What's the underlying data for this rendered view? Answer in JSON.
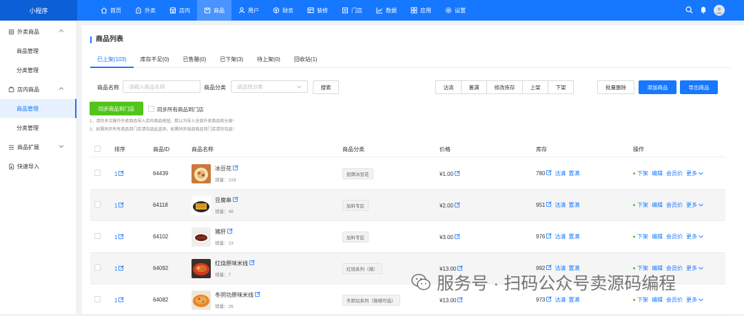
{
  "app": {
    "logo_text": "小程序"
  },
  "topnav": [
    {
      "label": "首页",
      "icon": "home-icon"
    },
    {
      "label": "外卖",
      "icon": "takeout-icon"
    },
    {
      "label": "店内",
      "icon": "store-icon"
    },
    {
      "label": "商品",
      "icon": "goods-icon",
      "active": true
    },
    {
      "label": "用户",
      "icon": "user-icon"
    },
    {
      "label": "财务",
      "icon": "finance-icon"
    },
    {
      "label": "装修",
      "icon": "decor-icon"
    },
    {
      "label": "门店",
      "icon": "shop-icon"
    },
    {
      "label": "数据",
      "icon": "chart-icon"
    },
    {
      "label": "应用",
      "icon": "apps-icon"
    },
    {
      "label": "设置",
      "icon": "gear-icon"
    }
  ],
  "sidebar": {
    "groups": [
      {
        "label": "外卖商品",
        "icon": "takeout-icon",
        "items": [
          "商品管理",
          "分类管理"
        ]
      },
      {
        "label": "店内商品",
        "icon": "store-icon",
        "items": [
          "商品管理",
          "分类管理"
        ]
      },
      {
        "label": "商品扩展",
        "icon": "list-icon",
        "items": []
      },
      {
        "label": "快速导入",
        "icon": "import-icon",
        "items": []
      }
    ],
    "active_item": "店内商品/商品管理"
  },
  "page": {
    "title": "商品列表",
    "tabs": [
      "已上架(103)",
      "库存不足(0)",
      "已售罄(0)",
      "已下架(3)",
      "待上架(0)",
      "回收站(1)"
    ],
    "active_tab": 0
  },
  "filters": {
    "name_label": "商品名称",
    "name_placeholder": "请输入商品名称",
    "category_label": "商品分类",
    "category_placeholder": "请选择分类",
    "search_button": "搜索"
  },
  "actions": {
    "group_buttons": [
      "沽清",
      "置满",
      "修改库存",
      "上架",
      "下架"
    ],
    "batch_delete": "批量删除",
    "add": "添加商品",
    "export": "导出商品"
  },
  "sync": {
    "button": "同步商品到门店",
    "checkbox_label": "同步所有商品到门店",
    "tips": [
      "1、请勿多次操作外卖商品导入店内商品按钮，默认为导入全部外卖商品和分类！",
      "2、如需同步所有商品到门店请勾选此选项，如需同步局部商品到门店请勿勾选！"
    ]
  },
  "table": {
    "headers": [
      "排序",
      "商品ID",
      "商品名称",
      "商品分类",
      "价格",
      "库存",
      "操作"
    ],
    "rows": [
      {
        "sort": "1",
        "id": "64439",
        "name": "冰豆花",
        "sales": "销量：219",
        "category": "招牌冰豆花",
        "price": "¥1.00",
        "stock": "780",
        "thumb": "bowl"
      },
      {
        "sort": "1",
        "id": "64118",
        "name": "豆腐串",
        "sales": "销量：48",
        "category": "加料专区",
        "price": "¥2.00",
        "stock": "951",
        "thumb": "tofu"
      },
      {
        "sort": "1",
        "id": "64102",
        "name": "猪肝",
        "sales": "销量：23",
        "category": "加料专区",
        "price": "¥3.00",
        "stock": "976",
        "thumb": "liver"
      },
      {
        "sort": "1",
        "id": "64092",
        "name": "红烧原味米线",
        "sales": "销量：7",
        "category": "红烧系列（辣）",
        "price": "¥13.00",
        "stock": "992",
        "thumb": "noodle"
      },
      {
        "sort": "1",
        "id": "64082",
        "name": "冬阴功原味米线",
        "sales": "销量：26",
        "category": "冬阴功系列（微辣可选）",
        "price": "¥13.00",
        "stock": "973",
        "thumb": "tomyum"
      }
    ],
    "stock_links": [
      "沽清",
      "置满"
    ],
    "ops": [
      "下架",
      "编辑",
      "会员价",
      "更多"
    ]
  },
  "watermark": {
    "text": "服务号 · 扫码公众号卖源码编程"
  }
}
